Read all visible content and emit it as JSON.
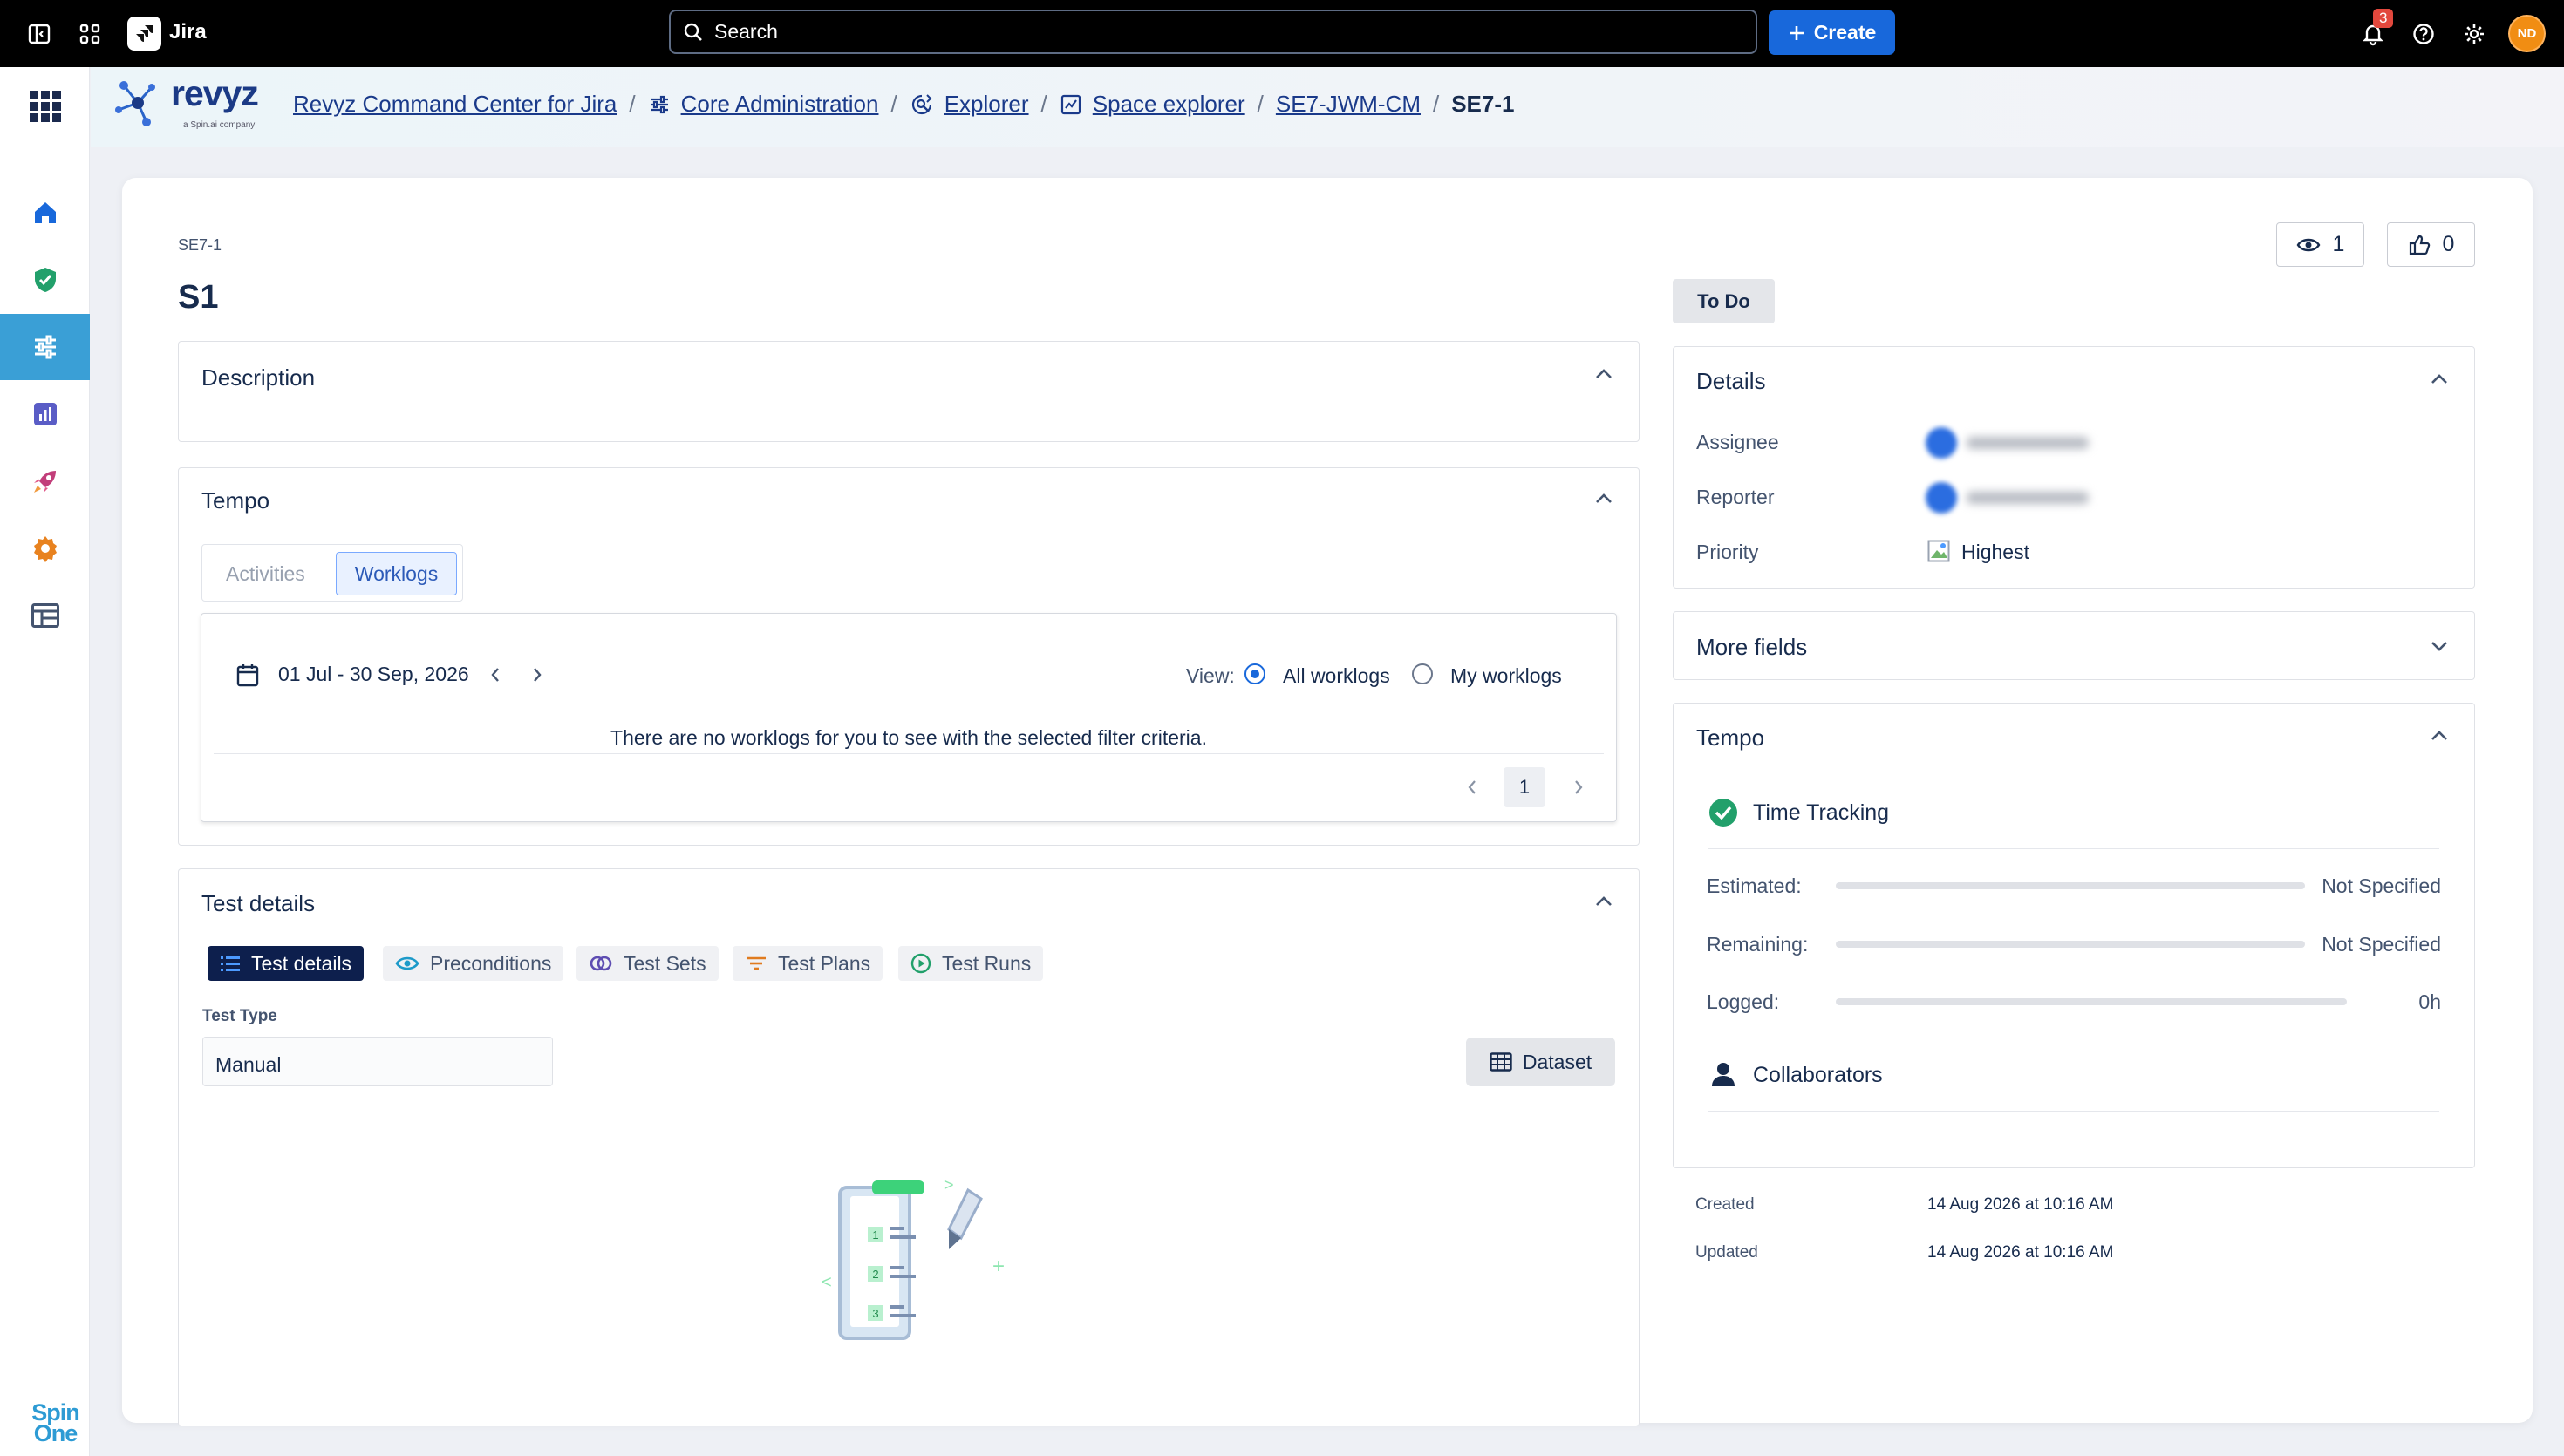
{
  "topbar": {
    "app_name": "Jira",
    "search_placeholder": "Search",
    "create_label": "Create",
    "notification_count": "3",
    "user_initials": "ND"
  },
  "brand": {
    "logo_text": "revyz",
    "logo_sub": "a Spin.ai company",
    "footer_logo": "Spin One"
  },
  "breadcrumb": {
    "items": [
      {
        "label": "Revyz Command Center for Jira"
      },
      {
        "label": "Core Administration"
      },
      {
        "label": "Explorer"
      },
      {
        "label": "Space explorer"
      },
      {
        "label": "SE7-JWM-CM"
      }
    ],
    "current": "SE7-1"
  },
  "issue": {
    "key": "SE7-1",
    "title": "S1",
    "status": "To Do",
    "watchers": "1",
    "votes": "0"
  },
  "description": {
    "heading": "Description"
  },
  "tempo": {
    "heading": "Tempo",
    "tabs": {
      "activities": "Activities",
      "worklogs": "Worklogs"
    },
    "date_range": "01 Jul - 30 Sep, 2026",
    "view_label": "View:",
    "view_options": {
      "all": "All worklogs",
      "mine": "My worklogs"
    },
    "selected_view": "All worklogs",
    "empty_message": "There are no worklogs for you to see with the selected filter criteria.",
    "page": "1"
  },
  "test_details": {
    "heading": "Test details",
    "tabs": {
      "details": "Test details",
      "preconditions": "Preconditions",
      "sets": "Test Sets",
      "plans": "Test Plans",
      "runs": "Test Runs"
    },
    "test_type_label": "Test Type",
    "test_type_value": "Manual",
    "dataset_label": "Dataset"
  },
  "details": {
    "heading": "Details",
    "assignee_label": "Assignee",
    "reporter_label": "Reporter",
    "priority_label": "Priority",
    "priority_value": "Highest"
  },
  "more_fields": {
    "heading": "More fields"
  },
  "tempo_panel": {
    "heading": "Tempo",
    "time_tracking": "Time Tracking",
    "estimated_label": "Estimated:",
    "estimated_value": "Not Specified",
    "remaining_label": "Remaining:",
    "remaining_value": "Not Specified",
    "logged_label": "Logged:",
    "logged_value": "0h",
    "collaborators": "Collaborators"
  },
  "meta": {
    "created_label": "Created",
    "created_value": "14 Aug 2026 at 10:16 AM",
    "updated_label": "Updated",
    "updated_value": "14 Aug 2026 at 10:16 AM"
  },
  "colors": {
    "accent": "#1868db",
    "rail_active": "#3a9fd6",
    "success": "#22a06b"
  }
}
